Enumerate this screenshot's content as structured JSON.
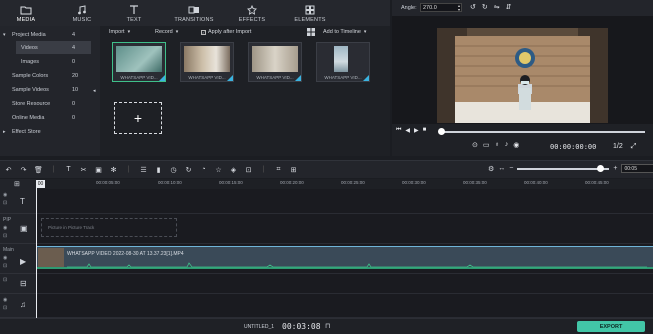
{
  "top_tabs": [
    {
      "label": "MEDIA",
      "icon": "folder-icon"
    },
    {
      "label": "MUSIC",
      "icon": "music-icon"
    },
    {
      "label": "TEXT",
      "icon": "text-icon"
    },
    {
      "label": "TRANSITIONS",
      "icon": "transitions-icon"
    },
    {
      "label": "EFFECTS",
      "icon": "effects-icon"
    },
    {
      "label": "ELEMENTS",
      "icon": "elements-icon"
    }
  ],
  "library": {
    "items": [
      {
        "name": "Project Media",
        "count": "4"
      },
      {
        "name": "Videos",
        "count": "4"
      },
      {
        "name": "Images",
        "count": "0"
      },
      {
        "name": "Sample Colors",
        "count": "20"
      },
      {
        "name": "Sample Videos",
        "count": "10"
      },
      {
        "name": "Store Resource",
        "count": "0"
      },
      {
        "name": "Online Media",
        "count": "0"
      },
      {
        "name": "Effect Store",
        "count": ""
      }
    ]
  },
  "media_toolbar": {
    "import": "Import",
    "record": "Record",
    "apply_after_import": "Apply after Import",
    "add_to_timeline": "Add to Timeline"
  },
  "media_items": [
    {
      "caption": "WHATSAPP VID..."
    },
    {
      "caption": "WHATSAPP VID..."
    },
    {
      "caption": "WHATSAPP VID..."
    },
    {
      "caption": "WHATSAPP VID..."
    }
  ],
  "import_placeholder": "+",
  "preview": {
    "angle_label": "Angle:",
    "angle_value": "270.0",
    "timecode": "00:00:00:00",
    "quality": "1/2"
  },
  "timeline": {
    "zoom_value": "00:05",
    "ruler_ticks": [
      "00:00",
      "00:00:05:00",
      "00:00:10:00",
      "00:00:15:00",
      "00:00:20:00",
      "00:00:25:00",
      "00:00:30:00",
      "00:00:35:00",
      "00:00:40:00",
      "00:00:45:00"
    ],
    "playhead_label": "00",
    "pip_track_label": "Picture in Picture Track",
    "main_label": "Main",
    "pip_label": "PIP",
    "clip_label": "WHATSAPP VIDEO 2022-08-30 AT 13.37.23[1].MP4"
  },
  "bottom": {
    "project_name": "UNTITLED_1",
    "project_timecode": "00:03:08",
    "export_label": "EXPORT"
  },
  "colors": {
    "accent": "#42c6a7",
    "selection": "#3fbf8a",
    "clip_top": "#6fb4d8"
  }
}
